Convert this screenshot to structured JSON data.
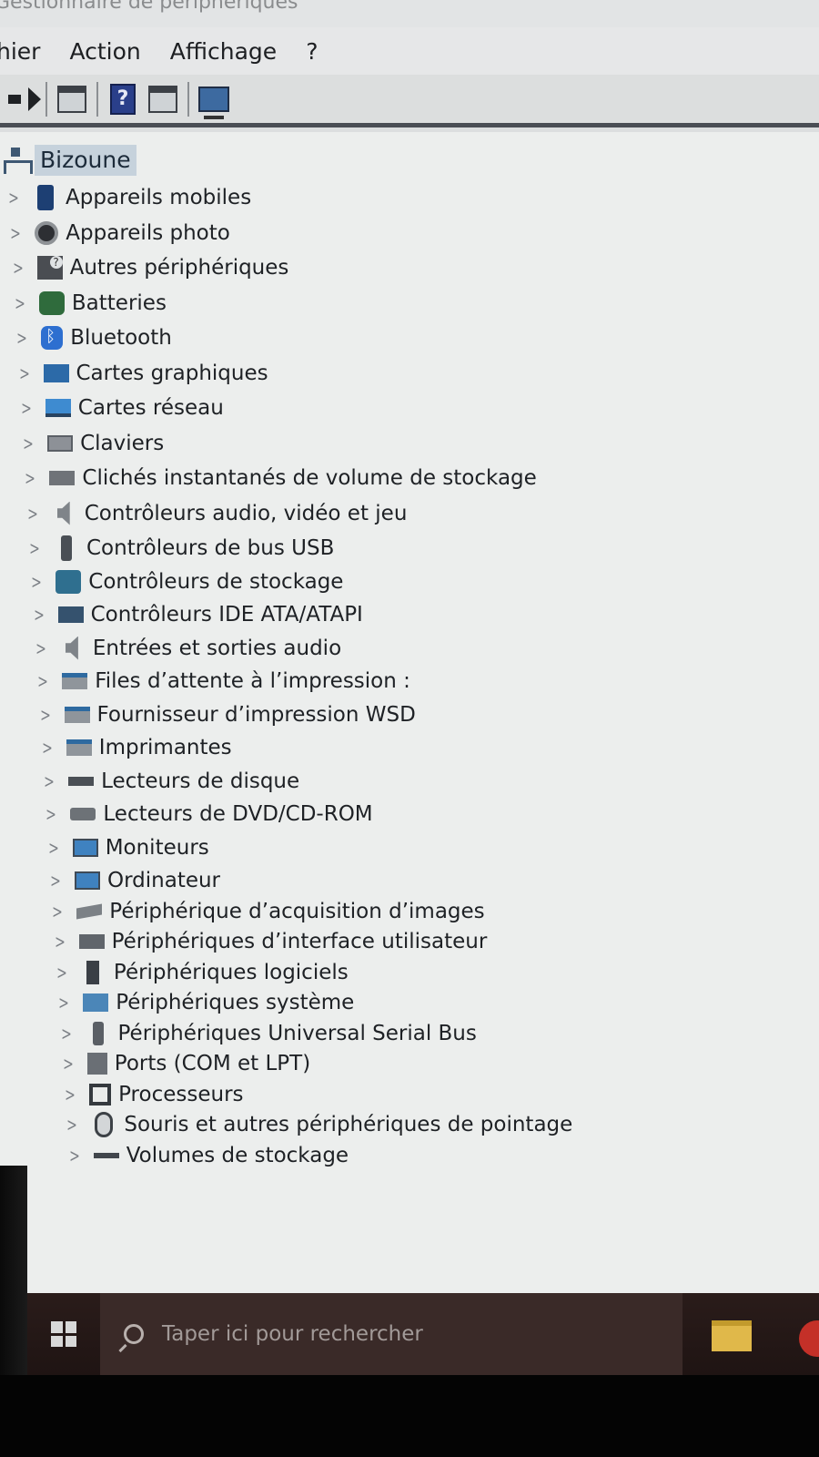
{
  "window": {
    "title": "Gestionnaire de périphériques"
  },
  "menu": {
    "items": [
      "hier",
      "Action",
      "Affichage",
      "?"
    ]
  },
  "tree": {
    "root": "Bizoune",
    "items": [
      {
        "label": "Appareils mobiles",
        "icon": "mobile-device-icon",
        "cls": "mobile"
      },
      {
        "label": "Appareils photo",
        "icon": "camera-icon",
        "cls": "camera"
      },
      {
        "label": "Autres périphériques",
        "icon": "unknown-device-icon",
        "cls": "other"
      },
      {
        "label": "Batteries",
        "icon": "battery-icon",
        "cls": "battery"
      },
      {
        "label": "Bluetooth",
        "icon": "bluetooth-icon",
        "cls": "bt"
      },
      {
        "label": "Cartes graphiques",
        "icon": "display-adapter-icon",
        "cls": "gpu"
      },
      {
        "label": "Cartes réseau",
        "icon": "network-adapter-icon",
        "cls": "net"
      },
      {
        "label": "Claviers",
        "icon": "keyboard-icon",
        "cls": "kbd"
      },
      {
        "label": "Clichés instantanés de volume de stockage",
        "icon": "storage-snapshot-icon",
        "cls": "snap"
      },
      {
        "label": "Contrôleurs audio, vidéo et jeu",
        "icon": "speaker-icon",
        "cls": "audio"
      },
      {
        "label": "Contrôleurs de bus USB",
        "icon": "usb-icon",
        "cls": "usb"
      },
      {
        "label": "Contrôleurs de stockage",
        "icon": "storage-controller-icon",
        "cls": "storage"
      },
      {
        "label": "Contrôleurs IDE ATA/ATAPI",
        "icon": "ide-controller-icon",
        "cls": "ide"
      },
      {
        "label": "Entrées et sorties audio",
        "icon": "speaker-icon",
        "cls": "audio"
      },
      {
        "label": "Files d’attente à l’impression :",
        "icon": "printer-icon",
        "cls": "printer"
      },
      {
        "label": "Fournisseur d’impression WSD",
        "icon": "printer-icon",
        "cls": "printer"
      },
      {
        "label": "Imprimantes",
        "icon": "printer-icon",
        "cls": "printer"
      },
      {
        "label": "Lecteurs de disque",
        "icon": "disk-drive-icon",
        "cls": "disk"
      },
      {
        "label": "Lecteurs de DVD/CD-ROM",
        "icon": "dvd-drive-icon",
        "cls": "dvd"
      },
      {
        "label": "Moniteurs",
        "icon": "monitor-icon",
        "cls": "monitor"
      },
      {
        "label": "Ordinateur",
        "icon": "computer-icon",
        "cls": "monitor"
      },
      {
        "label": "Périphérique d’acquisition d’images",
        "icon": "scanner-icon",
        "cls": "scanner"
      },
      {
        "label": "Périphériques d’interface utilisateur",
        "icon": "hid-icon",
        "cls": "hid"
      },
      {
        "label": "Périphériques logiciels",
        "icon": "software-device-icon",
        "cls": "soft"
      },
      {
        "label": "Périphériques système",
        "icon": "system-device-icon",
        "cls": "sys"
      },
      {
        "label": "Périphériques Universal Serial Bus",
        "icon": "usb-icon",
        "cls": "usbdev"
      },
      {
        "label": "Ports (COM et LPT)",
        "icon": "port-icon",
        "cls": "ports"
      },
      {
        "label": "Processeurs",
        "icon": "processor-icon",
        "cls": "cpu"
      },
      {
        "label": "Souris et autres périphériques de pointage",
        "icon": "mouse-icon",
        "cls": "mouse"
      },
      {
        "label": "Volumes de stockage",
        "icon": "storage-volume-icon",
        "cls": "volume"
      }
    ]
  },
  "taskbar": {
    "search_placeholder": "Taper ici pour rechercher"
  }
}
